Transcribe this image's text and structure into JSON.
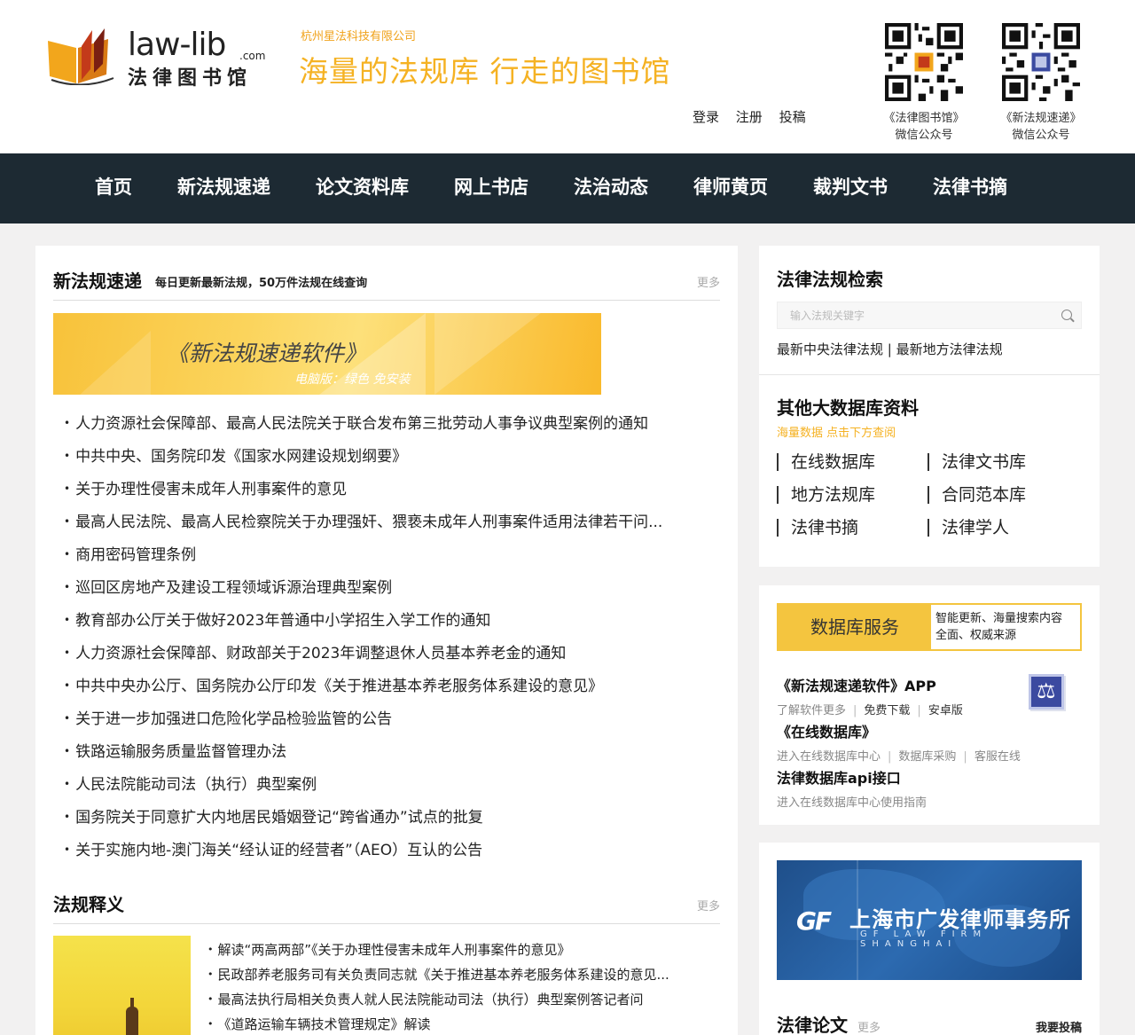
{
  "header": {
    "logo_en": "law-lib",
    "logo_com": ".com",
    "logo_cn": "法律图书馆",
    "company": "杭州星法科技有限公司",
    "slogan": "海量的法规库  行走的图书馆",
    "links": [
      "登录",
      "注册",
      "投稿"
    ],
    "qrcodes": [
      {
        "line1": "《法律图书馆》",
        "line2": "微信公众号"
      },
      {
        "line1": "《新法规速递》",
        "line2": "微信公众号"
      }
    ]
  },
  "nav": [
    "首页",
    "新法规速递",
    "论文资料库",
    "网上书店",
    "法治动态",
    "律师黄页",
    "裁判文书",
    "法律书摘"
  ],
  "news": {
    "title": "新法规速递",
    "subtitle": "每日更新最新法规，50万件法规在线查询",
    "more": "更多",
    "banner_title": "《新法规速递软件》",
    "banner_sub": "电脑版：绿色 免安装",
    "items": [
      "人力资源社会保障部、最高人民法院关于联合发布第三批劳动人事争议典型案例的通知",
      "中共中央、国务院印发《国家水网建设规划纲要》",
      "关于办理性侵害未成年人刑事案件的意见",
      "最高人民法院、最高人民检察院关于办理强奸、猥亵未成年人刑事案件适用法律若干问...",
      "商用密码管理条例",
      "巡回区房地产及建设工程领域诉源治理典型案例",
      "教育部办公厅关于做好2023年普通中小学招生入学工作的通知",
      "人力资源社会保障部、财政部关于2023年调整退休人员基本养老金的通知",
      "中共中央办公厅、国务院办公厅印发《关于推进基本养老服务体系建设的意见》",
      "关于进一步加强进口危险化学品检验监管的公告",
      "铁路运输服务质量监督管理办法",
      "人民法院能动司法（执行）典型案例",
      "国务院关于同意扩大内地居民婚姻登记“跨省通办”试点的批复",
      "关于实施内地-澳门海关“经认证的经营者”（AEO）互认的公告"
    ]
  },
  "interp": {
    "title": "法规释义",
    "more": "更多",
    "items": [
      "解读“两高两部”《关于办理性侵害未成年人刑事案件的意见》",
      "民政部养老服务司有关负责同志就《关于推进基本养老服务体系建设的意见...",
      "最高法执行局相关负责人就人民法院能动司法（执行）典型案例答记者问",
      "《道路运输车辆技术管理规定》解读"
    ]
  },
  "sidebar": {
    "search_title": "法律法规检索",
    "search_placeholder": "输入法规关键字",
    "laws_link1": "最新中央法律法规",
    "laws_sep": " | ",
    "laws_link2": "最新地方法律法规",
    "db_title": "其他大数据库资料",
    "db_sub": "海量数据 点击下方查阅",
    "db_items": [
      "在线数据库",
      "法律文书库",
      "地方法规库",
      "合同范本库",
      "法律书摘",
      "法律学人"
    ],
    "svc_label": "数据库服务",
    "svc_desc1": "智能更新、海量搜索内容",
    "svc_desc2": "全面、权威来源",
    "svc1_title": "《新法规速递软件》APP",
    "svc1_links": [
      "了解软件更多",
      "免费下载",
      "安卓版"
    ],
    "svc2_title": "《在线数据库》",
    "svc2_links": [
      "进入在线数据库中心",
      "数据库采购",
      "客服在线"
    ],
    "svc3_title": "法律数据库api接口",
    "svc3_links": [
      "进入在线数据库中心使用指南"
    ],
    "ad_gf": "GF",
    "ad_name": "上海市广发律师事务所",
    "ad_en": "GF LAW FIRM SHANGHAI",
    "papers_title": "法律论文",
    "papers_more": "更多",
    "papers_submit": "我要投稿"
  }
}
